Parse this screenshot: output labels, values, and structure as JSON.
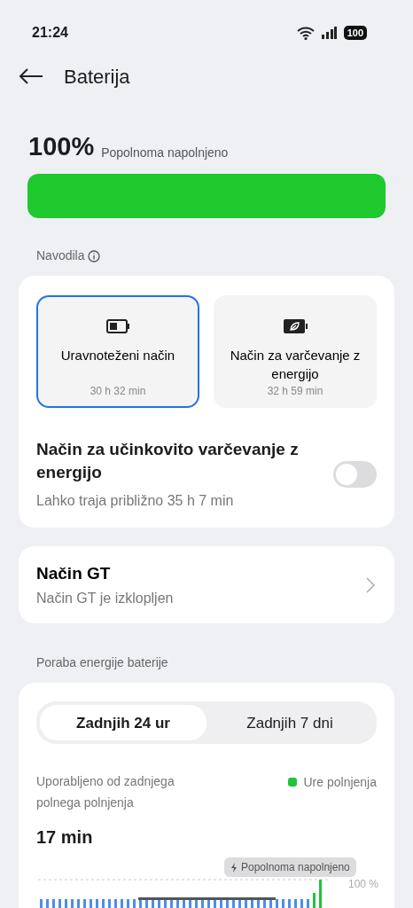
{
  "status_bar": {
    "time": "21:24",
    "battery": "100"
  },
  "header": {
    "title": "Baterija"
  },
  "battery": {
    "percent": "100%",
    "status": "Popolnoma napolnjeno",
    "level": 1.0
  },
  "guide": {
    "label": "Navodila",
    "modes": [
      {
        "kind": "balanced",
        "name": "Uravnoteženi način",
        "duration": "30 h 32 min",
        "selected": true
      },
      {
        "kind": "saver",
        "name": "Način za varčevanje z energijo",
        "duration": "32 h 59 min",
        "selected": false
      }
    ],
    "efficient": {
      "title": "Način za učinkovito varčevanje z energijo",
      "subtitle": "Lahko traja približno 35 h 7 min",
      "on": false
    }
  },
  "gt_mode": {
    "title": "Način GT",
    "subtitle": "Način GT je izklopljen"
  },
  "usage": {
    "heading": "Poraba energije baterije",
    "tabs": [
      {
        "label": "Zadnjih 24 ur",
        "selected": true
      },
      {
        "label": "Zadnjih 7 dni",
        "selected": false
      }
    ],
    "caption": "Uporabljeno od zadnjega polnega polnjenja",
    "value": "17 min",
    "legend": "Ure polnjenja",
    "tooltip": "Popolnoma napolnjeno",
    "axis_label": "100 %"
  }
}
